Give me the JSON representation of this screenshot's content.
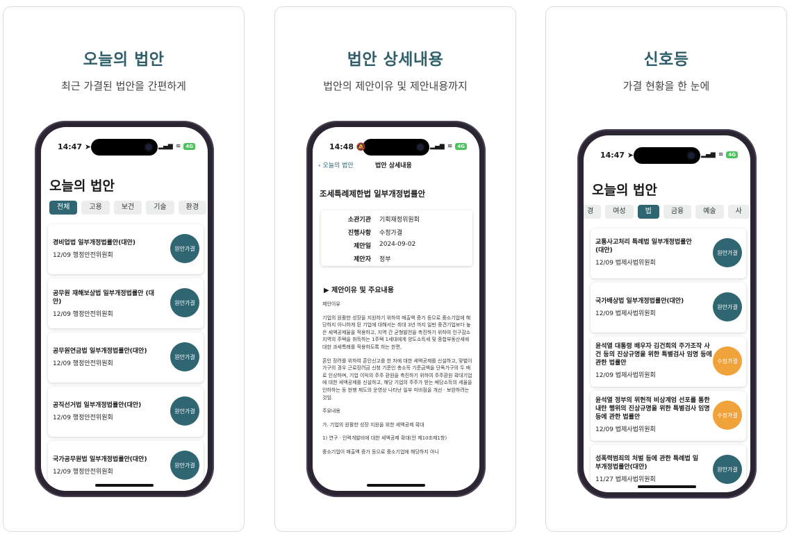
{
  "panels": [
    {
      "title": "오늘의 법안",
      "subtitle": "최근 가결된 법안을 간편하게",
      "status": {
        "time": "14:47",
        "time_icon": "location-arrow-icon",
        "battery": "4G"
      },
      "screen_title": "오늘의 법안",
      "chips": [
        "전체",
        "고용",
        "보건",
        "기술",
        "환경"
      ],
      "active_chip": "전체",
      "cards": [
        {
          "title": "경비업법 일부개정법률안(대안)",
          "meta": "12/09 행정안전위원회",
          "badge": "원안가결",
          "color": "#2f6672"
        },
        {
          "title": "공무원 재해보상법 일부개정법률안 (대안)",
          "meta": "12/09 행정안전위원회",
          "badge": "원안가결",
          "color": "#2f6672"
        },
        {
          "title": "공무원연금법 일부개정법률안(대안)",
          "meta": "12/09 행정안전위원회",
          "badge": "원안가결",
          "color": "#2f6672"
        },
        {
          "title": "공직선거법 일부개정법률안(대안)",
          "meta": "12/09 행정안전위원회",
          "badge": "원안가결",
          "color": "#2f6672"
        },
        {
          "title": "국가공무원법 일부개정법률안(대안)",
          "meta": "12/09 행정안전위원회",
          "badge": "원안가결",
          "color": "#2f6672"
        }
      ]
    },
    {
      "title": "법안 상세내용",
      "subtitle": "법안의 제안이유 및 제안내용까지",
      "status": {
        "time": "14:48",
        "time_icon": "bell-muted-icon",
        "battery": "4G"
      },
      "nav": {
        "back": "오늘의 법안",
        "title": "법안 상세내용"
      },
      "bill_title": "조세특례제한법 일부개정법률안",
      "info": [
        {
          "key": "소관기관",
          "value": "기획재정위원회"
        },
        {
          "key": "진행사항",
          "value": "수정가결"
        },
        {
          "key": "제안일",
          "value": "2024-09-02"
        },
        {
          "key": "제안자",
          "value": "정부"
        }
      ],
      "section": "▶ 제안이유 및 주요내용",
      "paragraphs": [
        "제안이유",
        "기업의 원활한 성장을 지원하기 위하여 매출액 증가 등으로 중소기업에 해당하지 아니하게 된 기업에 대해서는 최대 3년 까지 일반 중견기업보다 높은 세액공제율을 적용하고, 지역 간 균형발전을 촉진하기 위하여 인구감소지역의 주택을 취득하는 1주택 1세대에게 양도소득세 및 종합부동산세에 대한 과세특례를 적용하도록 하는 한편,",
        "혼인 장려를 위하여 혼인신고를 한 자에 대한 세액공제를 신설하고, 맞벌이 가구의 경우 근로장려금 신청 기준인 총소득 기준금액을 단독가구의 두 배로 인상하며, 기업 이익의 주주 환원을 촉진하기 위하여 주주환원 확대기업에 대한 세액공제를 신설하고, 해당 기업의 주주가 받는 배당소득의 세율을 인하하는 등 현행 제도의 운영상 나타난 일부 미비점을 개선 · 보완하려는 것임.",
        "주요내용",
        "가. 기업의 원활한 성장 지원을 위한 세액공제 확대",
        "1) 연구 · 인력개발비에 대한 세액공제 확대(안 제10조제1항)",
        "중소기업이 매출액 증가 등으로 중소기업에 해당하지 아니"
      ]
    },
    {
      "title": "신호등",
      "subtitle": "가결 현황을 한 눈에",
      "status": {
        "time": "14:47",
        "time_icon": "location-arrow-icon",
        "battery": "4G"
      },
      "screen_title": "오늘의 법안",
      "chips": [
        "경",
        "여성",
        "법",
        "금융",
        "예술",
        "사"
      ],
      "active_chip": "법",
      "cards": [
        {
          "title": "교통사고처리 특례법 일부개정법률안 (대안)",
          "meta": "12/09 법제사법위원회",
          "badge": "원안가결",
          "color": "#2f6672"
        },
        {
          "title": "국가배상법 일부개정법률안(대안)",
          "meta": "12/09 법제사법위원회",
          "badge": "원안가결",
          "color": "#2f6672"
        },
        {
          "title": "윤석열 대통령 배우자 김건희의 주가조작 사건 등의 진상규명을 위한 특별검사 임명 등에 관한 법률안",
          "meta": "12/09 법제사법위원회",
          "badge": "수정가결",
          "color": "#f0a33a"
        },
        {
          "title": "윤석열 정부의 위헌적 비상계엄 선포를 통한 내란 행위의 진상규명을 위한 특별검사 임명 등에 관한 법률안",
          "meta": "12/09 법제사법위원회",
          "badge": "수정가결",
          "color": "#f0a33a"
        },
        {
          "title": "성폭력범죄의 처벌 등에 관한 특례법 일부개정법률안(대안)",
          "meta": "11/27 법제사법위원회",
          "badge": "원안가결",
          "color": "#2f6672"
        }
      ]
    }
  ]
}
